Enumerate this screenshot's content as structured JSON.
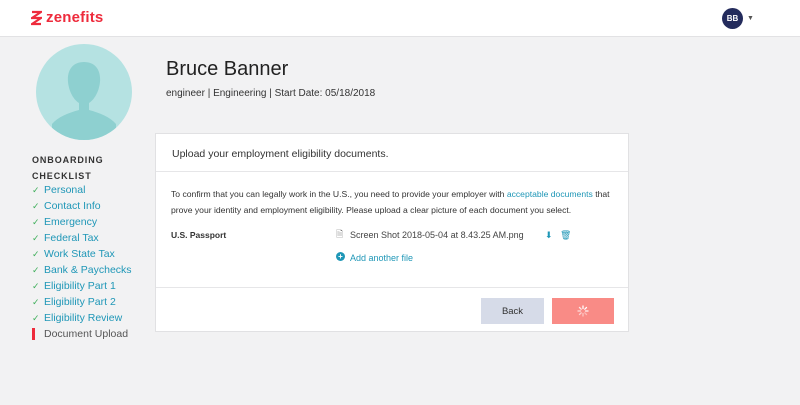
{
  "brand": {
    "name": "zenefits",
    "color": "#ee2b3c"
  },
  "user_menu": {
    "initials": "BB",
    "chevron_icon": "chevron-down-icon"
  },
  "profile": {
    "avatar_icon": "person-silhouette-icon"
  },
  "checklist": {
    "title": "ONBOARDING CHECKLIST",
    "items": [
      {
        "label": "Personal",
        "done": true
      },
      {
        "label": "Contact Info",
        "done": true
      },
      {
        "label": "Emergency",
        "done": true
      },
      {
        "label": "Federal Tax",
        "done": true
      },
      {
        "label": "Work State Tax",
        "done": true
      },
      {
        "label": "Bank & Paychecks",
        "done": true
      },
      {
        "label": "Eligibility Part 1",
        "done": true
      },
      {
        "label": "Eligibility Part 2",
        "done": true
      },
      {
        "label": "Eligibility Review",
        "done": true
      },
      {
        "label": "Document Upload",
        "done": false,
        "current": true
      }
    ]
  },
  "employee": {
    "name": "Bruce Banner",
    "subtitle": "engineer | Engineering | Start Date: 05/18/2018"
  },
  "card": {
    "header": "Upload your employment eligibility documents.",
    "intro_before_link": "To confirm that you can legally work in the U.S., you need to provide your employer with ",
    "intro_link": "acceptable documents",
    "intro_after_link": " that prove your identity and employment eligibility. Please upload a clear picture of each document you select.",
    "document": {
      "type": "U.S. Passport",
      "file_name": "Screen Shot 2018-05-04 at 8.43.25 AM.png"
    },
    "add_file_label": "Add another file",
    "back_label": "Back"
  },
  "colors": {
    "accent": "#1f97b7",
    "check": "#3fae5a",
    "submit": "#f98b86",
    "back": "#d6dbe8"
  }
}
